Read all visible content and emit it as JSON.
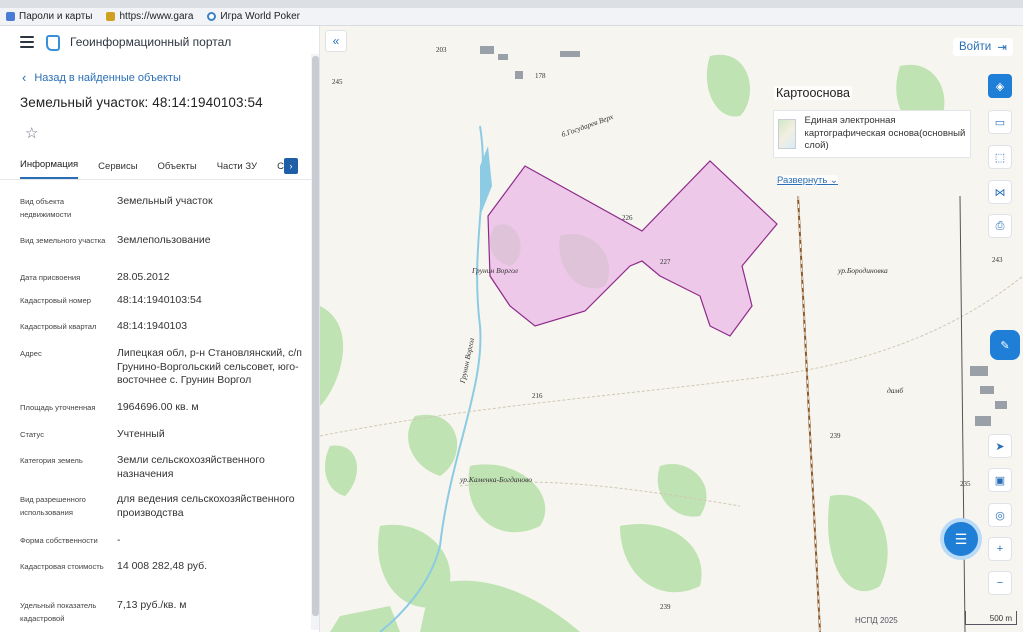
{
  "browser": {
    "bookmarks": [
      {
        "label": "Пароли и карты",
        "color": "#4a7cd6"
      },
      {
        "label": "https://www.gara",
        "color": "#d0a020"
      },
      {
        "label": "Игра World Poker",
        "color": "#3b82c6"
      }
    ]
  },
  "app": {
    "title": "Геоинформационный портал",
    "back_label": "Назад в найденные объекты",
    "object_title": "Земельный участок: 48:14:1940103:54"
  },
  "tabs": [
    {
      "label": "Информация"
    },
    {
      "label": "Сервисы"
    },
    {
      "label": "Объекты"
    },
    {
      "label": "Части ЗУ"
    },
    {
      "label": "Состав"
    }
  ],
  "properties": [
    {
      "key": "Вид объекта недвижимости",
      "value": "Земельный участок"
    },
    {
      "key": "Вид земельного участка",
      "value": "Землепользование"
    },
    {
      "key": "Дата присвоения",
      "value": "28.05.2012"
    },
    {
      "key": "Кадастровый номер",
      "value": "48:14:1940103:54"
    },
    {
      "key": "Кадастровый квартал",
      "value": "48:14:1940103"
    },
    {
      "key": "Адрес",
      "value": "Липецкая обл, р-н Становлянский, с/п Грунино-Воргольский сельсовет, юго-восточнее с. Грунин Воргол"
    },
    {
      "key": "Площадь уточненная",
      "value": "1964696.00 кв. м"
    },
    {
      "key": "Статус",
      "value": "Учтенный"
    },
    {
      "key": "Категория земель",
      "value": "Земли сельскохозяйственного назначения"
    },
    {
      "key": "Вид разрешенного использования",
      "value": "для ведения сельскохозяйственного производства"
    },
    {
      "key": "Форма собственности",
      "value": "-"
    },
    {
      "key": "Кадастровая стоимость",
      "value": "14 008 282,48 руб."
    },
    {
      "key": "Удельный показатель кадастровой",
      "value": "7,13 руб./кв. м"
    }
  ],
  "map": {
    "login_label": "Войти",
    "layer_panel_title": "Картооснова",
    "layer_name": "Единая электронная картографическая основа(основный слой)",
    "expand_label": "Развернуть",
    "copyright": "НСПД 2025",
    "scale_label": "500 m",
    "labels": [
      {
        "text": "Грунин Воргол"
      },
      {
        "text": "ур.Бородиновка"
      },
      {
        "text": "ур.Каменка-Богданово"
      },
      {
        "text": "б.Государев Верх"
      },
      {
        "text": "Грунин Воргол"
      },
      {
        "text": "дамб"
      }
    ],
    "heights": [
      "203",
      "245",
      "178",
      "226",
      "227",
      "216",
      "239",
      "235",
      "239",
      "243"
    ],
    "parcel_color": "#e9b8e6",
    "parcel_stroke": "#8e2a8c"
  }
}
